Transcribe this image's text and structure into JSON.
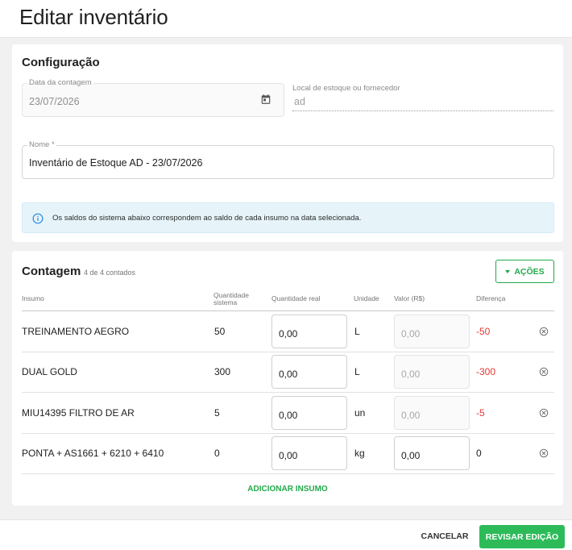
{
  "header": {
    "title": "Editar inventário"
  },
  "config": {
    "title": "Configuração",
    "date_field": {
      "label": "Data da contagem",
      "value": "23/07/2026",
      "icon": "calendar-icon"
    },
    "local_field": {
      "label": "Local de estoque ou fornecedor",
      "value": "ad"
    },
    "name_field": {
      "label": "Nome *",
      "value": "Inventário de Estoque AD - 23/07/2026"
    },
    "info": {
      "icon": "info-icon",
      "text": "Os saldos do sistema abaixo correspondem ao saldo de cada insumo na data selecionada."
    }
  },
  "count": {
    "title": "Contagem",
    "subtitle": "4 de 4 contados",
    "actions_label": "AÇÕES",
    "columns": {
      "insumo": "Insumo",
      "qty_system_1": "Quantidade",
      "qty_system_2": "sistema",
      "qty_real": "Quantidade real",
      "unit": "Unidade",
      "value": "Valor (R$)",
      "diff": "Diferença"
    },
    "rows": [
      {
        "name": "TREINAMENTO AEGRO",
        "qty_system": "50",
        "qty_real": "0,00",
        "unit": "L",
        "value": "0,00",
        "value_disabled": true,
        "diff": "-50",
        "diff_negative": true
      },
      {
        "name": "DUAL GOLD",
        "qty_system": "300",
        "qty_real": "0,00",
        "unit": "L",
        "value": "0,00",
        "value_disabled": true,
        "diff": "-300",
        "diff_negative": true
      },
      {
        "name": "MIU14395 FILTRO DE AR",
        "qty_system": "5",
        "qty_real": "0,00",
        "unit": "un",
        "value": "0,00",
        "value_disabled": true,
        "diff": "-5",
        "diff_negative": true
      },
      {
        "name": "PONTA + AS1661 + 6210 + 6410",
        "qty_system": "0",
        "qty_real": "0,00",
        "unit": "kg",
        "value": "0,00",
        "value_disabled": false,
        "diff": "0",
        "diff_negative": false
      }
    ],
    "add_label": "ADICIONAR INSUMO"
  },
  "footer": {
    "cancel_label": "CANCELAR",
    "review_label": "REVISAR EDIÇÃO"
  },
  "colors": {
    "accent": "#22a94a",
    "negative": "#e53935",
    "info_bg": "#e6f4fa"
  }
}
